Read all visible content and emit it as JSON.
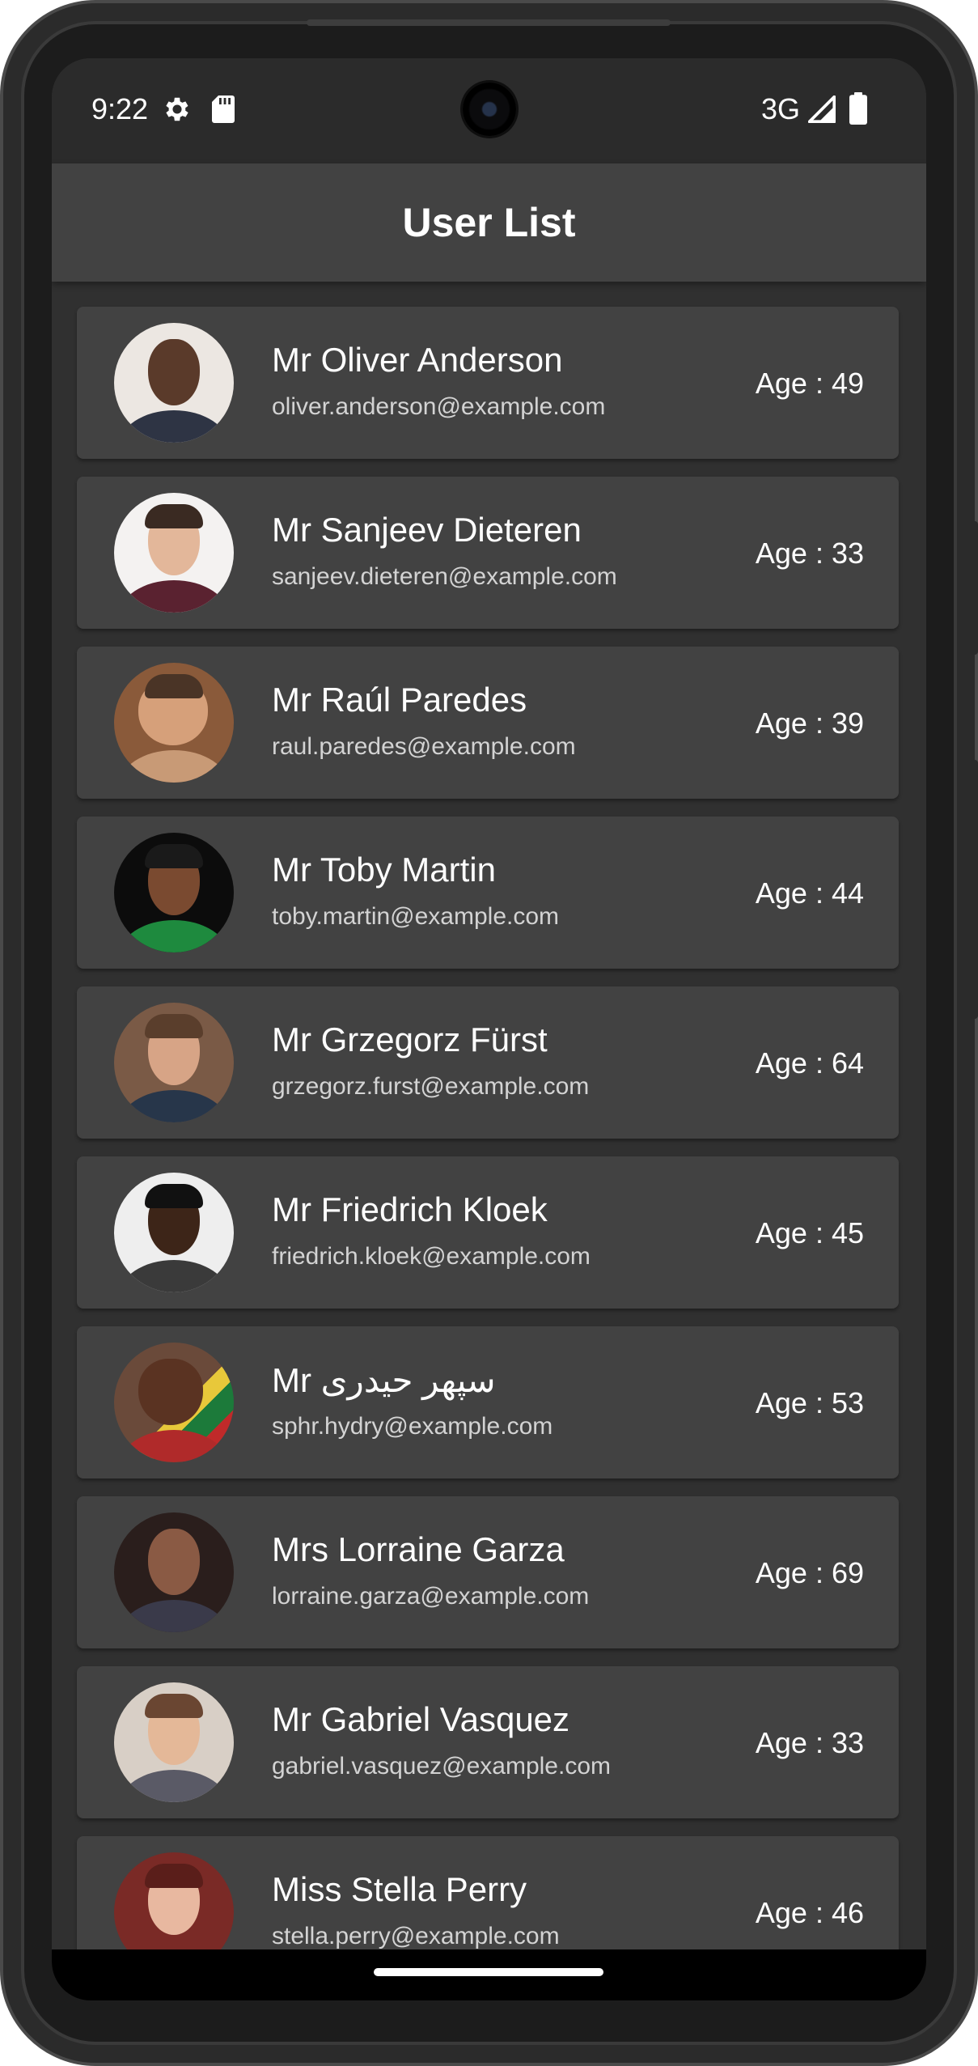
{
  "status_bar": {
    "time": "9:22",
    "network": "3G",
    "icons": [
      "gear-icon",
      "sd-card-icon",
      "signal-icon",
      "battery-icon"
    ]
  },
  "app_bar": {
    "title": "User List"
  },
  "users": [
    {
      "name": "Mr Oliver Anderson",
      "email": "oliver.anderson@example.com",
      "age": "Age : 49"
    },
    {
      "name": "Mr Sanjeev Dieteren",
      "email": "sanjeev.dieteren@example.com",
      "age": "Age : 33"
    },
    {
      "name": "Mr Raúl Paredes",
      "email": "raul.paredes@example.com",
      "age": "Age : 39"
    },
    {
      "name": "Mr Toby Martin",
      "email": "toby.martin@example.com",
      "age": "Age : 44"
    },
    {
      "name": "Mr Grzegorz Fürst",
      "email": "grzegorz.furst@example.com",
      "age": "Age : 64"
    },
    {
      "name": "Mr Friedrich Kloek",
      "email": "friedrich.kloek@example.com",
      "age": "Age : 45"
    },
    {
      "name": "Mr سپهر حیدری",
      "email": "sphr.hydry@example.com",
      "age": "Age : 53"
    },
    {
      "name": "Mrs Lorraine Garza",
      "email": "lorraine.garza@example.com",
      "age": "Age : 69"
    },
    {
      "name": "Mr Gabriel Vasquez",
      "email": "gabriel.vasquez@example.com",
      "age": "Age : 33"
    },
    {
      "name": "Miss Stella Perry",
      "email": "stella.perry@example.com",
      "age": "Age : 46"
    }
  ],
  "colors": {
    "screen_background": "#303030",
    "app_bar": "#424242",
    "card": "#424242",
    "primary_text": "#ffffff",
    "secondary_text": "#d3d3d3"
  }
}
